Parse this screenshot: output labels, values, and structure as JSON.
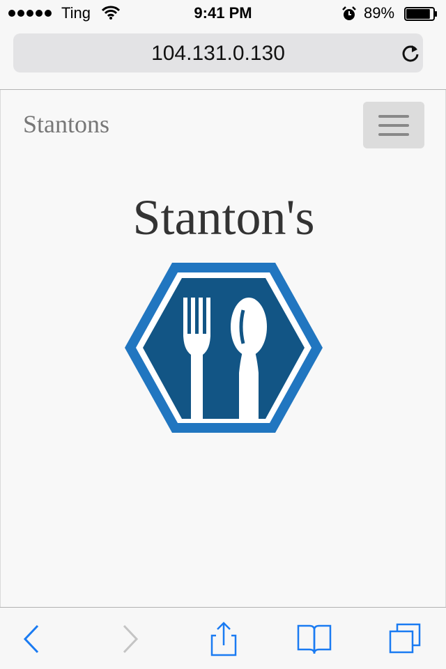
{
  "status_bar": {
    "carrier": "Ting",
    "time": "9:41 PM",
    "battery_percent": "89%",
    "battery_level": 0.89,
    "signal_bars": 5
  },
  "browser": {
    "url": "104.131.0.130",
    "icons": {
      "reload": "reload-icon",
      "back": "chevron-left-icon",
      "forward": "chevron-right-icon",
      "share": "share-icon",
      "bookmarks": "book-icon",
      "tabs": "tabs-icon"
    },
    "accent_color": "#1a7bf2"
  },
  "page": {
    "brand": "Stantons",
    "title": "Stanton's",
    "logo_icon": "fork-spoon-hexagon-icon",
    "colors": {
      "logo_outer": "#2176c0",
      "logo_inner": "#125585"
    }
  }
}
